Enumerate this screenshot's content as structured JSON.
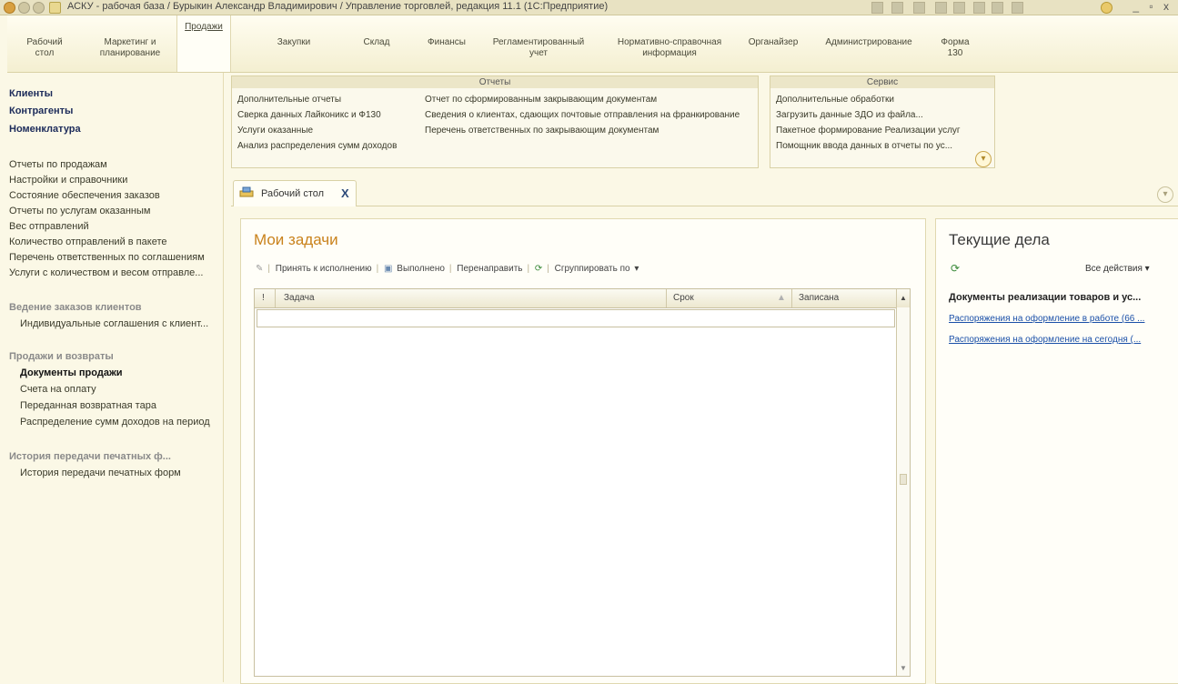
{
  "window": {
    "title": "АСКУ - рабочая база / Бурыкин Александр Владимирович / Управление торговлей, редакция 11.1   (1С:Предприятие)",
    "controls": "_ ▫ x"
  },
  "sections": [
    {
      "label": "Рабочий\nстол"
    },
    {
      "label": "Маркетинг и\nпланирование"
    },
    {
      "label": "Продажи",
      "active": true
    },
    {
      "label": "Закупки"
    },
    {
      "label": "Склад"
    },
    {
      "label": "Финансы"
    },
    {
      "label": "Регламентированный\nучет"
    },
    {
      "label": "Нормативно-справочная\nинформация"
    },
    {
      "label": "Органайзер"
    },
    {
      "label": "Администрирование"
    },
    {
      "label": "Форма\n130"
    }
  ],
  "nav": {
    "main": [
      "Клиенты",
      "Контрагенты",
      "Номенклатура"
    ],
    "links": [
      "Отчеты по продажам",
      "Настройки и справочники",
      "Состояние обеспечения заказов",
      "Отчеты по услугам оказанным",
      "Вес отправлений",
      "Количество отправлений в пакете",
      "Перечень ответственных по соглашениям",
      "Услуги с количеством и весом отправле..."
    ],
    "group1": "Ведение заказов клиентов",
    "group1_items": [
      "Индивидуальные соглашения с клиент..."
    ],
    "group2": "Продажи и возвраты",
    "group2_items": [
      "Документы продажи",
      "Счета на оплату",
      "Переданная возвратная тара",
      "Распределение сумм доходов на период"
    ],
    "group3": "История передачи печатных ф...",
    "group3_items": [
      "История передачи печатных форм"
    ]
  },
  "actions": {
    "reports_title": "Отчеты",
    "reports_col1": [
      "Дополнительные отчеты",
      "Сверка данных Лайконикс и Ф130",
      "Услуги оказанные",
      "Анализ распределения сумм доходов"
    ],
    "reports_col2": [
      "Отчет по сформированным закрывающим документам",
      "Сведения о клиентах, сдающих почтовые отправления на франкирование",
      "Перечень ответственных по закрывающим документам"
    ],
    "service_title": "Сервис",
    "service_items": [
      "Дополнительные обработки",
      "Загрузить данные ЗДО из файла...",
      "Пакетное формирование Реализации услуг",
      "Помощник ввода данных в отчеты по ус..."
    ]
  },
  "tab": {
    "label": "Рабочий стол",
    "close": "X"
  },
  "tasks": {
    "title": "Мои задачи",
    "toolbar": [
      "Принять к исполнению",
      "Выполнено",
      "Перенаправить",
      "Сгруппировать по"
    ],
    "columns": {
      "flag": "!",
      "task": "Задача",
      "due": "Срок",
      "recorded": "Записана"
    }
  },
  "current": {
    "title": "Текущие дела",
    "all_actions": "Все действия",
    "doc_heading": "Документы реализации товаров и ус...",
    "links": [
      "Распоряжения на оформление в работе (66 ...",
      "Распоряжения на оформление на сегодня (..."
    ]
  },
  "colors": {
    "accent": "#c9821c",
    "link": "#1b50a8",
    "background": "#fbf8e6"
  }
}
